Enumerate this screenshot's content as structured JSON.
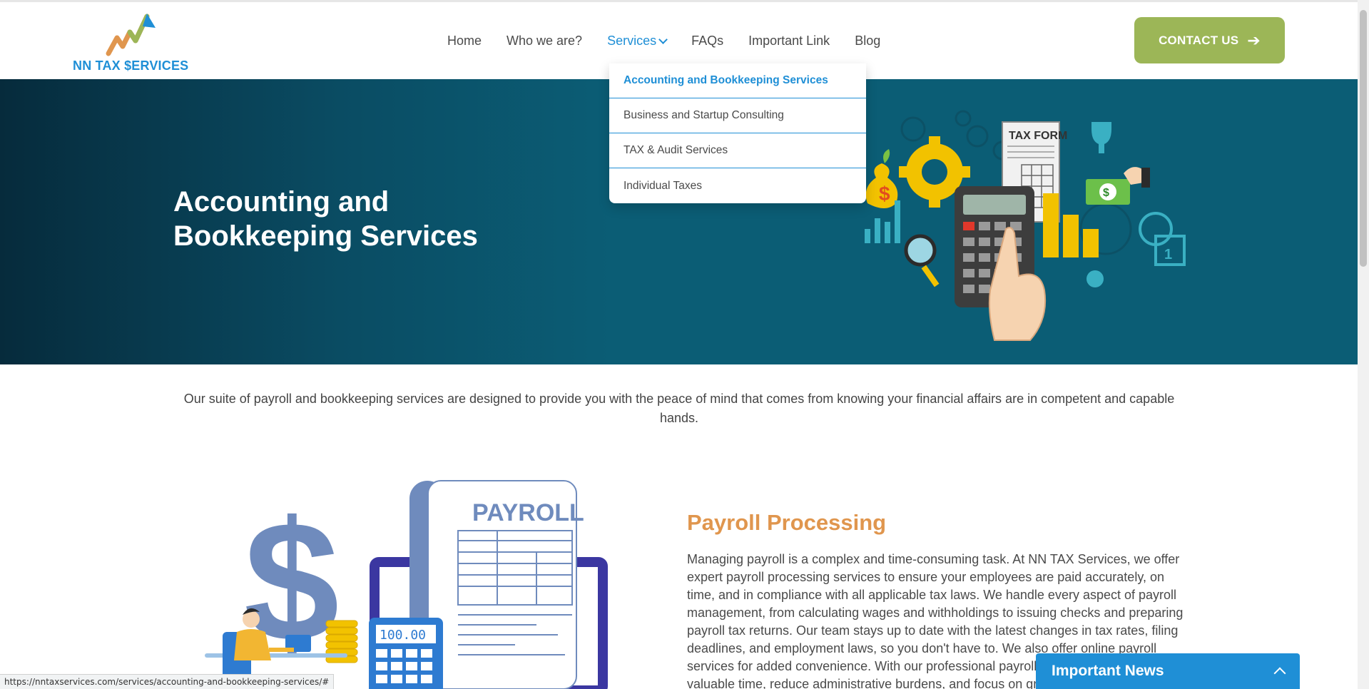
{
  "header": {
    "logo_text": "NN TAX $ERVICES",
    "nav": [
      {
        "label": "Home"
      },
      {
        "label": "Who we are?"
      },
      {
        "label": "Services"
      },
      {
        "label": "FAQs"
      },
      {
        "label": "Important Link"
      },
      {
        "label": "Blog"
      }
    ],
    "contact_label": "CONTACT US"
  },
  "dropdown": {
    "items": [
      {
        "label": "Accounting and Bookkeeping Services"
      },
      {
        "label": "Business and Startup Consulting"
      },
      {
        "label": "TAX & Audit Services"
      },
      {
        "label": "Individual Taxes"
      }
    ]
  },
  "hero": {
    "title": "Accounting and Bookkeeping Services",
    "art_tax_form": "TAX FORM"
  },
  "intro": {
    "text": "Our suite of payroll and bookkeeping services are designed to provide you with the peace of mind that comes from knowing your financial affairs are in competent and capable hands."
  },
  "payroll": {
    "title": "Payroll Processing",
    "text": "Managing payroll is a complex and time-consuming task. At NN TAX Services, we offer expert payroll processing services to ensure your employees are paid accurately, on time, and in compliance with all applicable tax laws. We handle every aspect of payroll management, from calculating wages and withholdings to issuing checks and preparing payroll tax returns. Our team stays up to date with the latest changes in tax rates, filing deadlines, and employment laws, so you don't have to. We also offer online payroll services for added convenience. With our professional payroll services, you can save valuable time, reduce administrative burdens, and focus on growing your business.",
    "illus_label": "PAYROLL",
    "calc_display": "100.00"
  },
  "news": {
    "label": "Important News"
  },
  "status": {
    "url": "https://nntaxservices.com/services/accounting-and-bookkeeping-services/#"
  },
  "colors": {
    "brand_blue": "#1f8fd6",
    "brand_green": "#9cb657",
    "accent_orange": "#e0964e",
    "hero_teal": "#0b5d75"
  }
}
